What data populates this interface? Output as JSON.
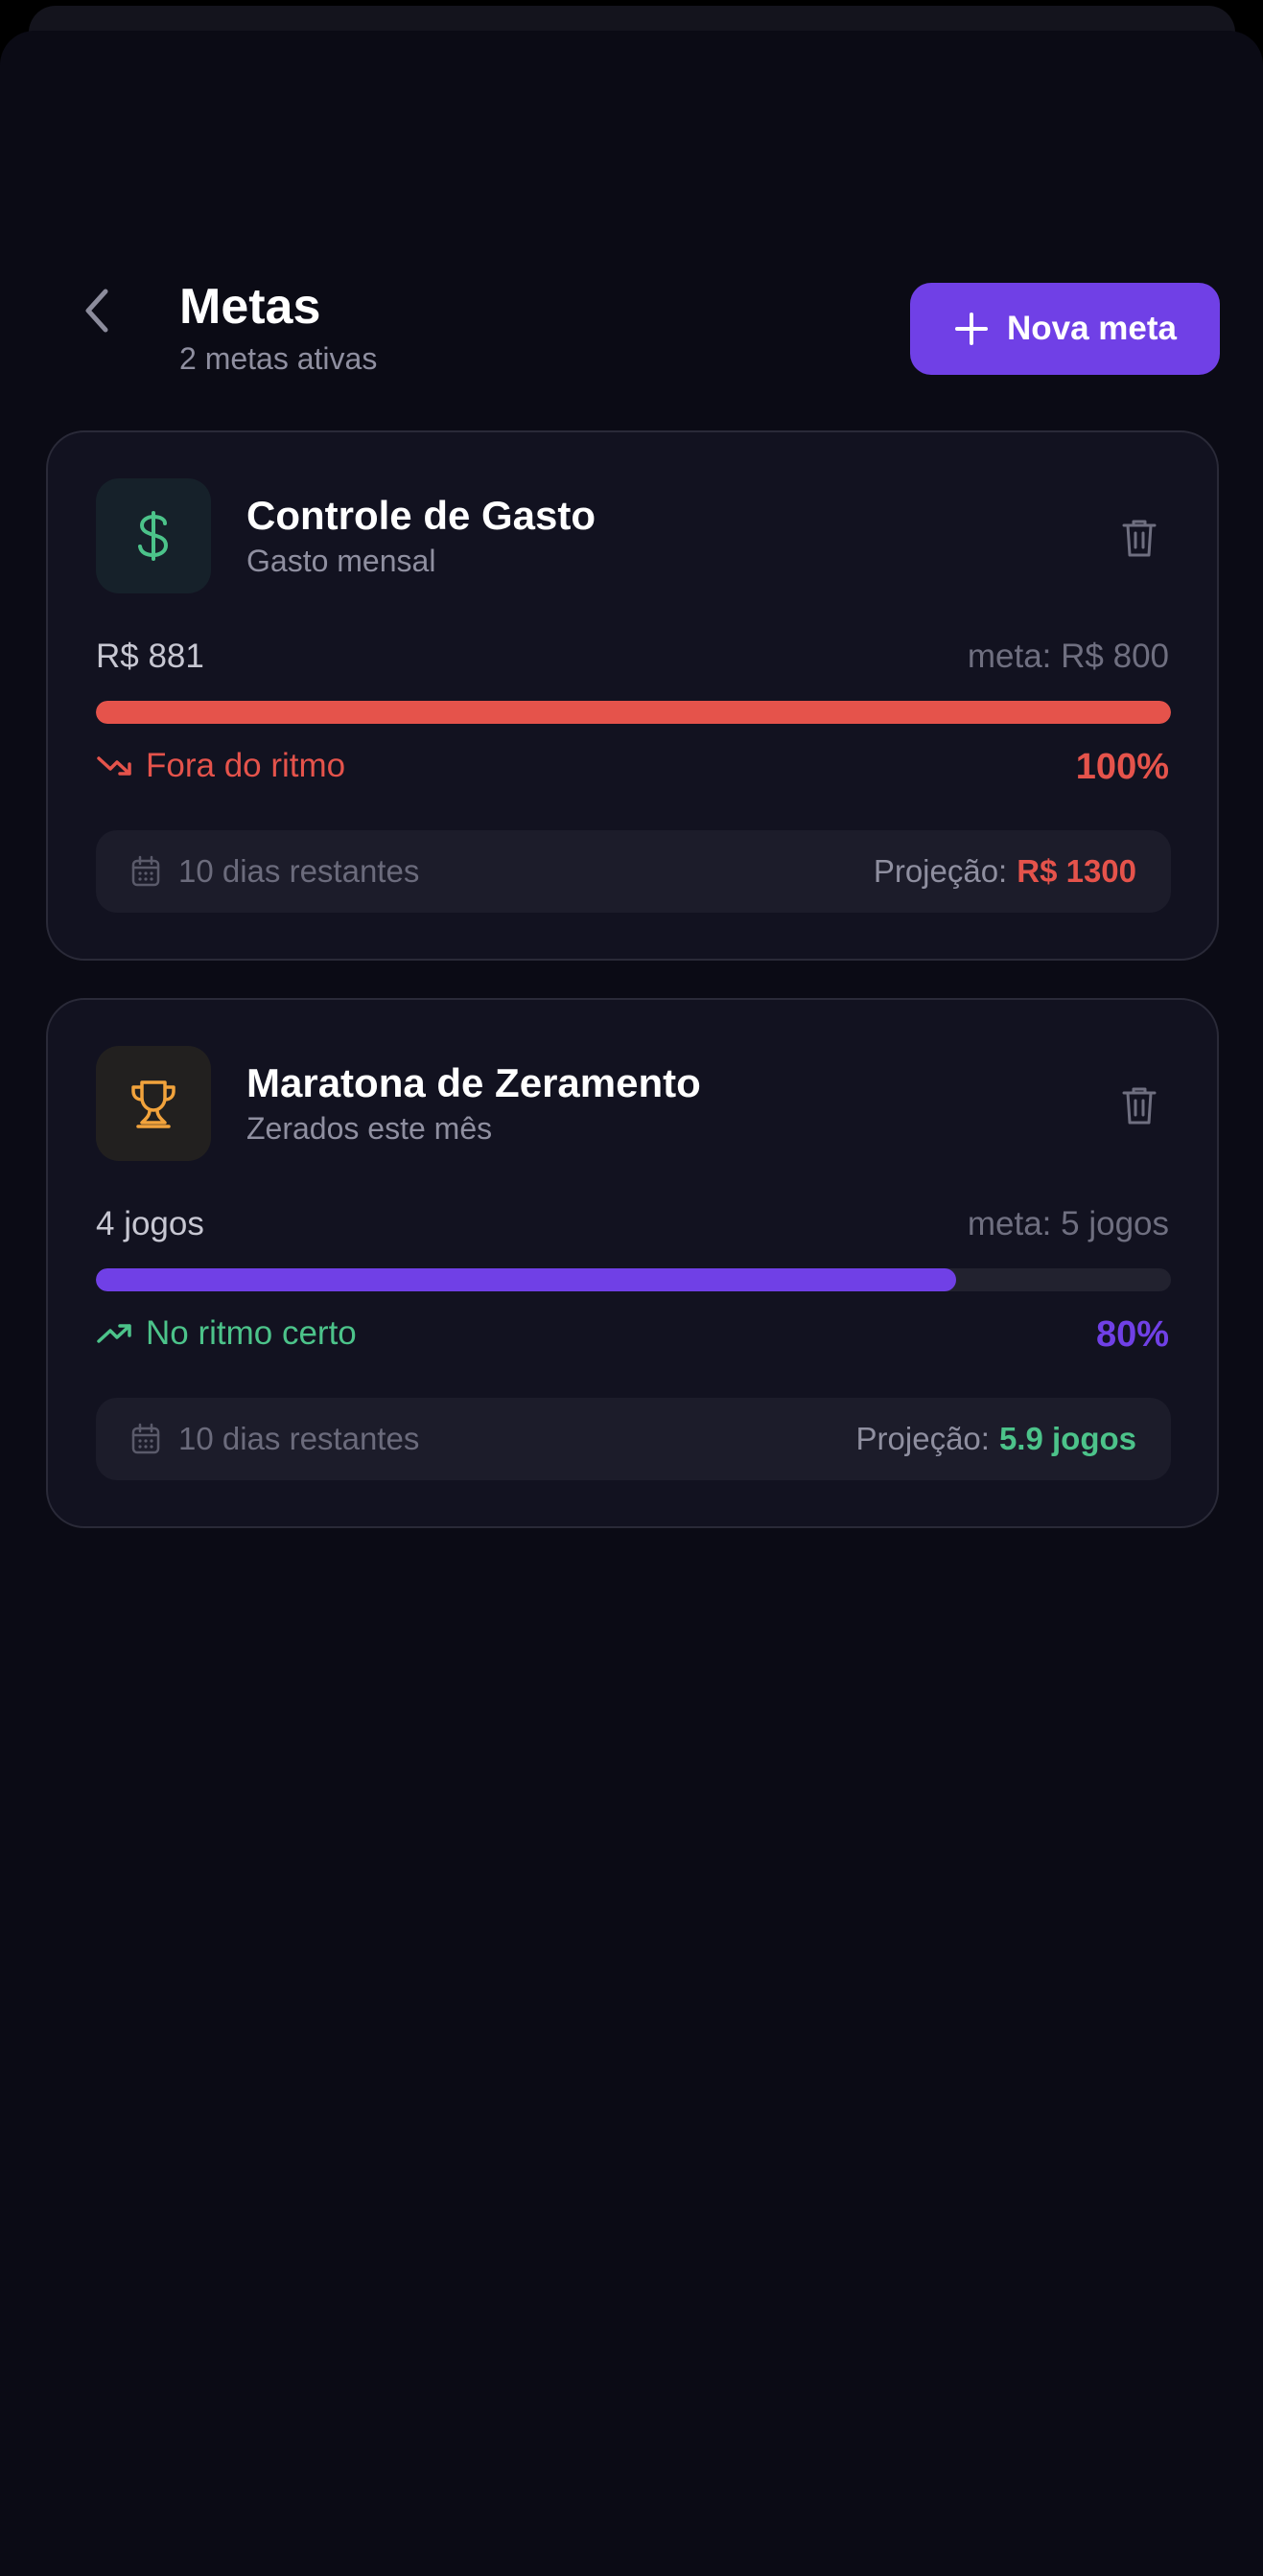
{
  "header": {
    "title": "Metas",
    "subtitle": "2 metas ativas",
    "new_button_label": "Nova meta"
  },
  "colors": {
    "background": "#0b0b15",
    "card": "#121220",
    "accent": "#7040e6",
    "danger": "#e5534b",
    "success": "#4cc38a",
    "warning": "#f2a33c"
  },
  "goals": [
    {
      "icon": "dollar-icon",
      "title": "Controle de Gasto",
      "subtitle": "Gasto mensal",
      "current": "R$ 881",
      "target": "meta: R$ 800",
      "progress": 1.0,
      "status": "Fora do ritmo",
      "status_icon": "trending-down-icon",
      "percent": "100%",
      "days_left": "10 dias restantes",
      "projection_label": "Projeção:",
      "projection_value": "R$ 1300"
    },
    {
      "icon": "trophy-icon",
      "title": "Maratona de Zeramento",
      "subtitle": "Zerados este mês",
      "current": "4 jogos",
      "target": "meta: 5 jogos",
      "progress": 0.8,
      "status": "No ritmo certo",
      "status_icon": "trending-up-icon",
      "percent": "80%",
      "days_left": "10 dias restantes",
      "projection_label": "Projeção:",
      "projection_value": "5.9 jogos"
    }
  ]
}
